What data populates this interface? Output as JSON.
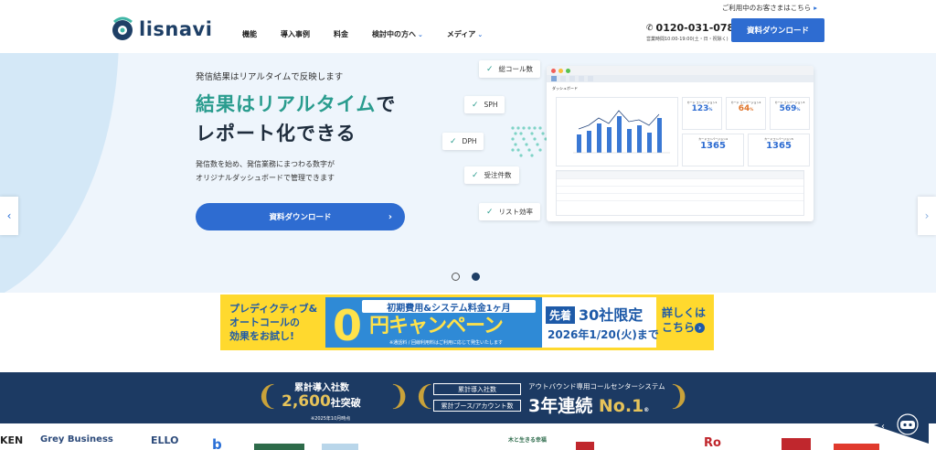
{
  "header": {
    "top_note": "ご利用中のお客さまはこちら",
    "logo_text": "lisnavi",
    "nav": [
      {
        "label": "機能",
        "dropdown": false
      },
      {
        "label": "導入事例",
        "dropdown": false
      },
      {
        "label": "料金",
        "dropdown": false
      },
      {
        "label": "検討中の方へ",
        "dropdown": true
      },
      {
        "label": "メディア",
        "dropdown": true
      }
    ],
    "phone": "0120-031-078",
    "hours": "営業時間10:00-19:00(土・日・祝除く)",
    "cta": "資料ダウンロード"
  },
  "hero": {
    "subtitle": "発信結果はリアルタイムで反映します",
    "title_line1_highlight": "結果はリアルタイム",
    "title_line1_rest": "で",
    "title_line2": "レポート化できる",
    "desc_line1": "発信数を始め、発信業務にまつわる数字が",
    "desc_line2": "オリジナルダッシュボードで管理できます",
    "cta": "資料ダウンロード",
    "tags": [
      "総コール数",
      "SPH",
      "DPH",
      "受注件数",
      "リスト効率"
    ],
    "dashboard": {
      "title": "ダッシュボード",
      "kpis": [
        {
          "label": "カード コンバージョン1",
          "value": "123",
          "unit": "%",
          "color": "#2e6cd1"
        },
        {
          "label": "カード コンバージョン2",
          "value": "64",
          "unit": "%",
          "color": "#e0742a"
        },
        {
          "label": "カード コンバージョン3",
          "value": "569",
          "unit": "%",
          "color": "#2e6cd1"
        },
        {
          "label": "カードコンバージョン4",
          "value": "1365",
          "color": "#2e6cd1"
        },
        {
          "label": "カードコンバージョン5",
          "value": "1365",
          "color": "#2e6cd1"
        }
      ]
    },
    "slider_active": 1
  },
  "banner": {
    "left_line1": "プレディクティブ&",
    "left_line2": "オートコールの",
    "left_line3": "効果をお試し!",
    "mid_top": "初期費用&システム料金1ヶ月",
    "zero": "0",
    "campaign": "円キャンペーン",
    "note": "※通話料 / 回線利用料はご利用に応じて発生いたします",
    "sentaku": "先着",
    "limit": "30社限定",
    "date": "2026年1/20(火)まで",
    "detail_line1": "詳しくは",
    "detail_line2": "こちら"
  },
  "award": {
    "label1": "累計導入社数",
    "value1": "2,600",
    "value1_suffix": "社突破",
    "note1": "※2025年10月時点",
    "box1": "累計導入社数",
    "box2": "累計ブース/アカウント数",
    "top2": "アウトバウンド専用コールセンターシステム",
    "value2": "3年連続",
    "value2_gold": "No.1",
    "value2_mark": "®"
  },
  "logos": [
    "KEN",
    "Grey Business",
    "ELLO",
    "b",
    "木と生きる幸福",
    "Ro"
  ]
}
